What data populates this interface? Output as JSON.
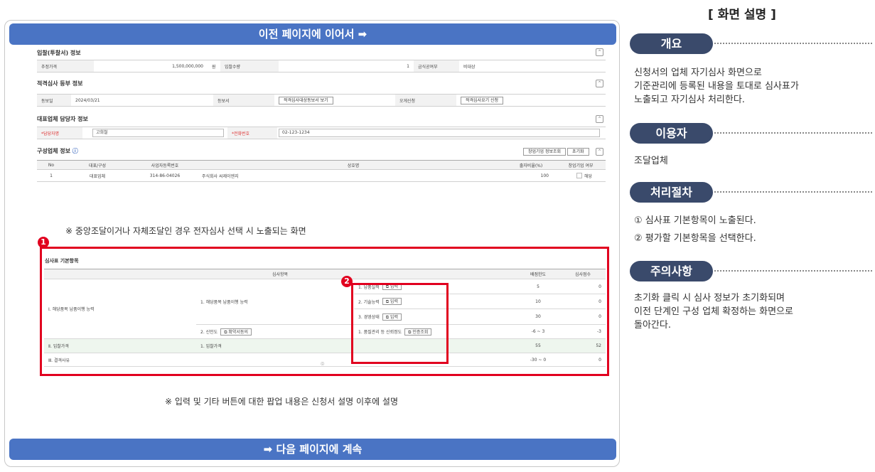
{
  "banners": {
    "top": "이전 페이지에 이어서 ➡",
    "bottom": "➡ 다음 페이지에 계속"
  },
  "bid_info": {
    "title": "입찰(투찰서) 정보",
    "labels": [
      "추정가격",
      "입찰수량",
      "금식공여부"
    ],
    "price": "1,500,000,000",
    "unit": "원",
    "qty": "1",
    "flag": "비대상"
  },
  "qual_info": {
    "title": "적격심사 등부 정보",
    "label_date": "동보일",
    "date": "2024/03/21",
    "label_doc": "등보서",
    "doc_btn": "적격심사대상동보서 보기",
    "label_apply": "오게신청",
    "apply_btn": "적격심사요기 신청"
  },
  "rep_info": {
    "title": "대표업체 담당자 정보",
    "label_name": "*담당자명",
    "name": "고희철",
    "label_phone": "*전화번호",
    "phone": "02-123-1234"
  },
  "member_info": {
    "title": "구성업체 정보",
    "btn_lookup": "창업기업 정보조회",
    "btn_reset": "초기화",
    "headers": [
      "No",
      "대표/구성",
      "사업자등록번호",
      "상호명",
      "출자비율(%)",
      "창업기업 여부"
    ],
    "rows": [
      {
        "no": "1",
        "type": "대표업체",
        "biz": "314-86-04026",
        "name": "주식회사 씨제이엔지",
        "ratio": "100",
        "startup": "해당"
      }
    ]
  },
  "note_top": "※ 중앙조달이거나 자체조달인 경우 전자심사 선택 시 노출되는 화면",
  "eval": {
    "title": "심사표 기본항목",
    "header_item": "심사항목",
    "header_score": "배점한도",
    "header_result": "심사점수",
    "group1": "Ⅰ. 해당품목 납품이행 능력",
    "sub1": "1. 해당품목 납품이행 능력",
    "items": [
      {
        "label": "1. 납품실적",
        "btn": "입력",
        "score": "5",
        "result": "0"
      },
      {
        "label": "2. 기술능력",
        "btn": "입력",
        "score": "10",
        "result": "0"
      },
      {
        "label": "3. 경영상태",
        "btn": "입력",
        "score": "30",
        "result": "0"
      }
    ],
    "sub2": "2. 신인도",
    "sub2_btn": "확약서동의",
    "sub2_item": "1. 품질관리 등 신뢰정도",
    "sub2_item_btn": "인증조회",
    "sub2_score": "-6 ~ 3",
    "sub2_result": "-3",
    "group2": "Ⅱ. 입찰가격",
    "group2_sub": "1. 입찰가격",
    "group2_score": "55",
    "group2_result": "52",
    "group3": "Ⅲ. 결격사유",
    "group3_score": "-30 ~ 0",
    "group3_result": "0"
  },
  "note_bottom": "※ 입력 및 기타 버튼에 대한 팝업 내용은 신청서 설명 이후에 설명",
  "markers": [
    "1",
    "2"
  ],
  "right": {
    "title": "[ 화면 설명 ]",
    "sections": [
      {
        "tag": "개요",
        "lines": [
          "신청서의 업체 자기심사 화면으로",
          "기준관리에 등록된 내용을 토대로 심사표가",
          "노출되고 자기심사 처리한다."
        ]
      },
      {
        "tag": "이용자",
        "lines": [
          "조달업체"
        ]
      },
      {
        "tag": "처리절차",
        "lines": [
          "① 심사표 기본항목이 노출된다.",
          "② 평가할 기본항목을 선택한다."
        ]
      },
      {
        "tag": "주의사항",
        "lines": [
          "초기화 클릭 시 심사 정보가 초기화되며",
          "이전 단계인 구성 업체 확정하는 화면으로",
          "돌아간다."
        ]
      }
    ]
  },
  "colors": {
    "banner": "#4a74c4",
    "tag": "#3a4a6b",
    "highlight": "#e1001f"
  }
}
